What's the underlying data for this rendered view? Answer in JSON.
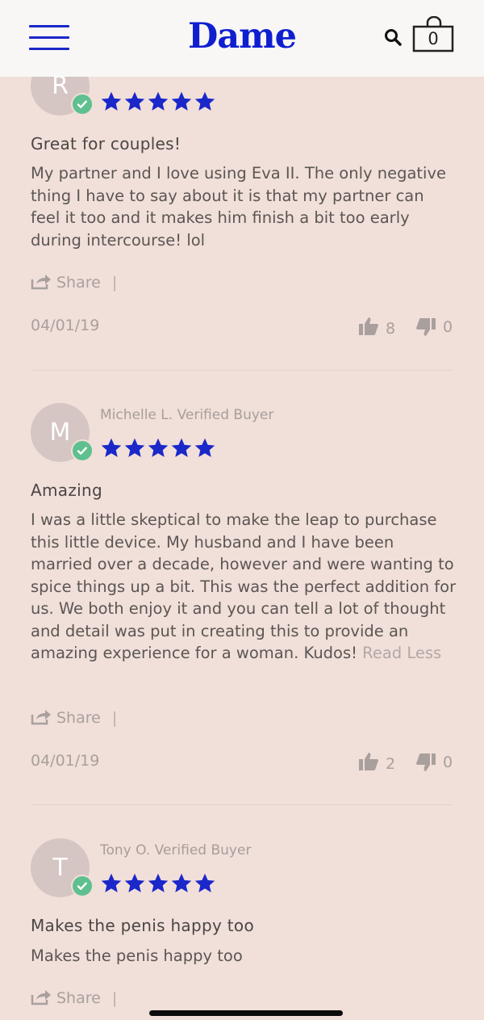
{
  "header": {
    "logo": "Dame",
    "cart_count": "0",
    "icons": [
      "hamburger-menu-icon",
      "search-icon",
      "shopping-bag-icon"
    ],
    "brand_color": "#0f1fd0"
  },
  "reviews": [
    {
      "initial": "R",
      "rating": 5,
      "title": "Great for couples!",
      "body": "My partner and I love using Eva II. The only negative thing I have to say about it is that my partner can feel it too and it makes him finish a bit too early during intercourse! lol",
      "share_label": "Share",
      "separator": "|",
      "date": "04/01/19",
      "upvotes": "8",
      "downvotes": "0"
    },
    {
      "initial": "M",
      "author": "Michelle L.",
      "badge": "Verified Buyer",
      "rating": 5,
      "title": "Amazing",
      "body": "I was a little skeptical to make the leap to purchase this little device. My husband and I have been married over a decade, however and were wanting to spice things up a bit. This was the perfect addition for us. We both enjoy it and you can tell a lot of thought and detail was put in creating this to provide an amazing experience for a woman. Kudos!",
      "read_less": "Read Less",
      "share_label": "Share",
      "separator": "|",
      "date": "04/01/19",
      "upvotes": "2",
      "downvotes": "0"
    },
    {
      "initial": "T",
      "author": "Tony O.",
      "badge": "Verified Buyer",
      "rating": 5,
      "title": "Makes the penis happy too",
      "body": "Makes the penis happy too",
      "share_label": "Share",
      "separator": "|"
    }
  ],
  "colors": {
    "background": "#f1dfd9",
    "star": "#1a27c9",
    "verified": "#5fc08f"
  }
}
